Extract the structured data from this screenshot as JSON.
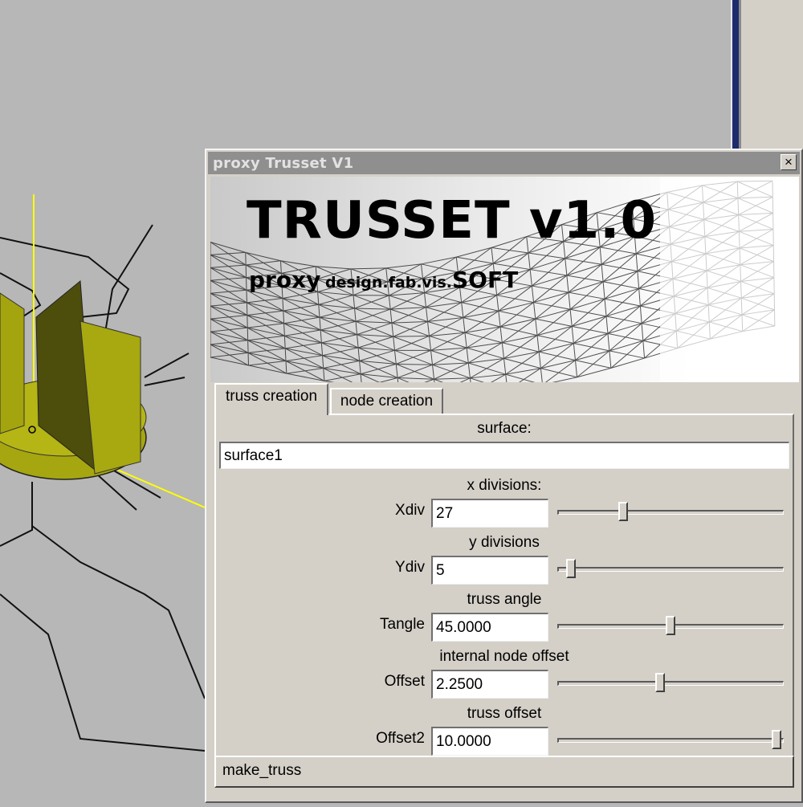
{
  "window": {
    "title": "proxy Trusset V1",
    "close_label": "×"
  },
  "banner": {
    "title": "TRUSSET v1.0",
    "sub_big": "proxy",
    "sub_small": "design.fab.vis.",
    "sub_mid": "SOFT"
  },
  "tabs": [
    {
      "label": "truss creation",
      "active": true
    },
    {
      "label": "node creation",
      "active": false
    }
  ],
  "surface": {
    "heading": "surface:",
    "value": "surface1"
  },
  "params": [
    {
      "heading": "x divisions:",
      "label": "Xdiv",
      "value": "27",
      "slider_fraction": 0.28
    },
    {
      "heading": "y divisions",
      "label": "Ydiv",
      "value": "5",
      "slider_fraction": 0.04
    },
    {
      "heading": "truss angle",
      "label": "Tangle",
      "value": "45.0000",
      "slider_fraction": 0.5
    },
    {
      "heading": "internal node offset",
      "label": "Offset",
      "value": "2.2500",
      "slider_fraction": 0.45
    },
    {
      "heading": "truss offset",
      "label": "Offset2",
      "value": "10.0000",
      "slider_fraction": 0.99
    }
  ],
  "make_button": "make_truss",
  "colors": {
    "viewport_bg": "#b7b7b7",
    "object_yellow": "#a6a610",
    "axis_yellow": "#ffff00",
    "window_bg": "#d4d0c8"
  }
}
